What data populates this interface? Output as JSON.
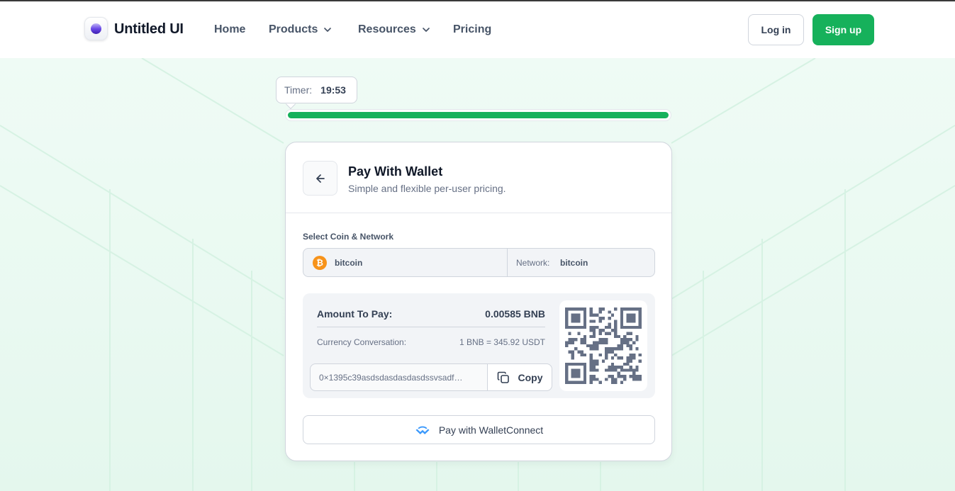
{
  "brand": {
    "name": "Untitled UI",
    "logo_icon": "gradient-circle-logo"
  },
  "nav": {
    "items": [
      {
        "label": "Home",
        "has_dropdown": false
      },
      {
        "label": "Products",
        "has_dropdown": true
      },
      {
        "label": "Resources",
        "has_dropdown": true
      },
      {
        "label": "Pricing",
        "has_dropdown": false
      }
    ],
    "login_label": "Log in",
    "signup_label": "Sign up"
  },
  "timer": {
    "label": "Timer:",
    "value": "19:53",
    "progress_percent": 100
  },
  "card": {
    "back_icon": "arrow-left-icon",
    "title": "Pay With Wallet",
    "subtitle": "Simple and flexible per-user pricing.",
    "select_label": "Select Coin & Network",
    "coin": {
      "icon": "bitcoin-icon",
      "symbol": "₿",
      "name": "bitcoin"
    },
    "network": {
      "label": "Network:",
      "value": "bitcoin"
    },
    "payment": {
      "amount_label": "Amount To Pay:",
      "amount_value": "0.00585 BNB",
      "conversion_label": "Currency Conversation:",
      "conversion_value": "1 BNB = 345.92 USDT",
      "address": "0×1395c39asdsdasdasdasdssvsadf…",
      "copy_label": "Copy",
      "qr_icon": "qr-code"
    },
    "walletconnect_label": "Pay with WalletConnect"
  },
  "colors": {
    "accent": "#16b15b",
    "hero_bg": "#effbf5",
    "bitcoin": "#f7931a",
    "walletconnect": "#3b99fc",
    "text_primary": "#101828",
    "text_secondary": "#667085"
  }
}
